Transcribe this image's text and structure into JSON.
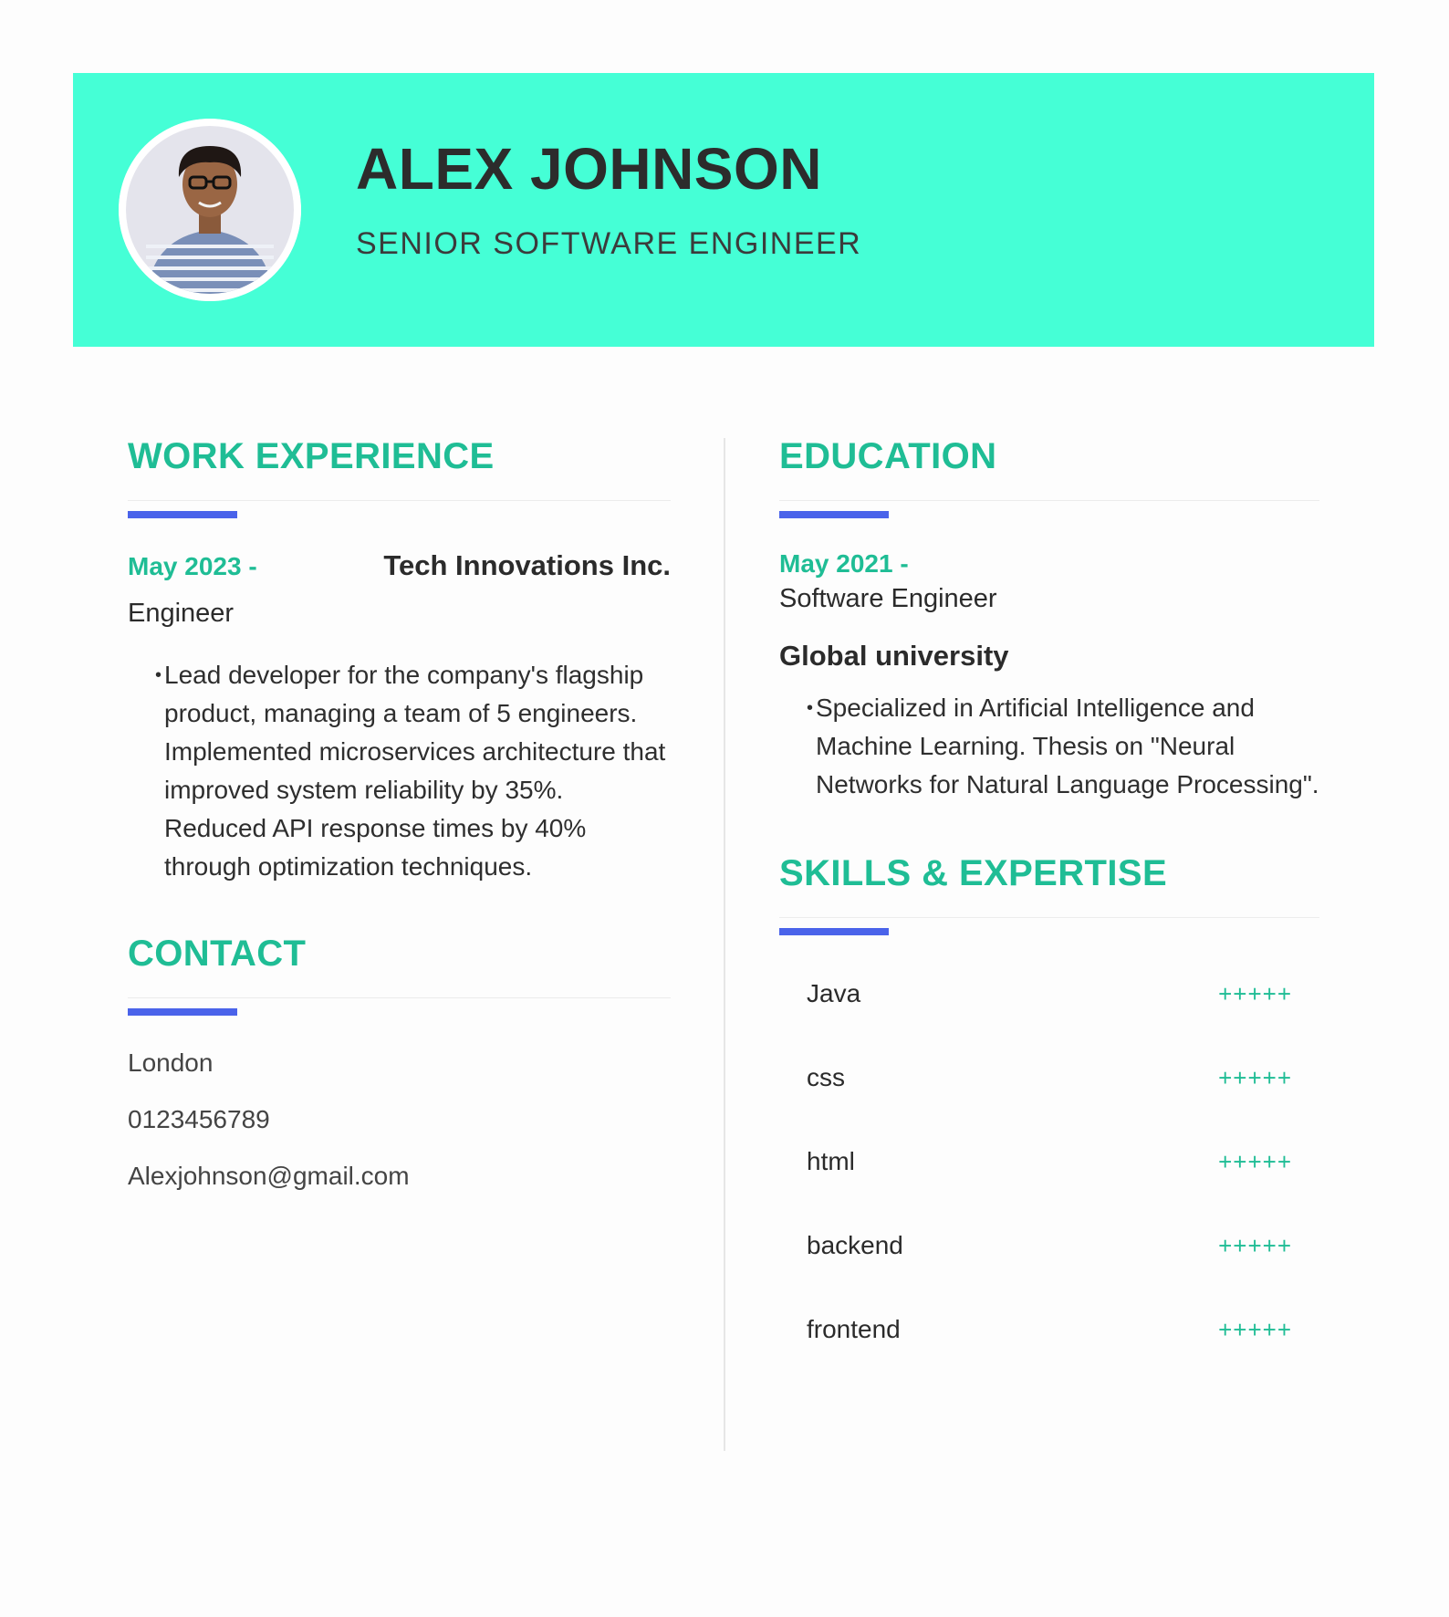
{
  "header": {
    "name": "ALEX JOHNSON",
    "title": "SENIOR SOFTWARE ENGINEER",
    "background_color": "#45ffd6"
  },
  "work": {
    "heading": "WORK EXPERIENCE",
    "date": "May 2023 -",
    "company": "Tech Innovations Inc.",
    "role": "Engineer",
    "bullet": "•",
    "description": "Lead developer for the company's flagship product, managing a team of 5 engineers. Implemented microservices architecture that improved system reliability by 35%. Reduced API response times by 40% through optimization techniques."
  },
  "contact": {
    "heading": "CONTACT",
    "items": [
      "London",
      "0123456789",
      "Alexjohnson@gmail.com"
    ]
  },
  "education": {
    "heading": "EDUCATION",
    "date": "May 2021 -",
    "degree": "Software Engineer",
    "school": "Global university",
    "bullet": "•",
    "description": "Specialized in Artificial Intelligence and Machine Learning. Thesis on \"Neural Networks for Natural Language Processing\"."
  },
  "skills": {
    "heading": "SKILLS & EXPERTISE",
    "items": [
      {
        "name": "Java",
        "rating": "+++++"
      },
      {
        "name": "css",
        "rating": "+++++"
      },
      {
        "name": "html",
        "rating": "+++++"
      },
      {
        "name": "backend",
        "rating": "+++++"
      },
      {
        "name": "frontend",
        "rating": "+++++"
      }
    ]
  },
  "colors": {
    "accent": "#1fbd95",
    "bar": "#4a63ea",
    "header": "#45ffd6"
  }
}
